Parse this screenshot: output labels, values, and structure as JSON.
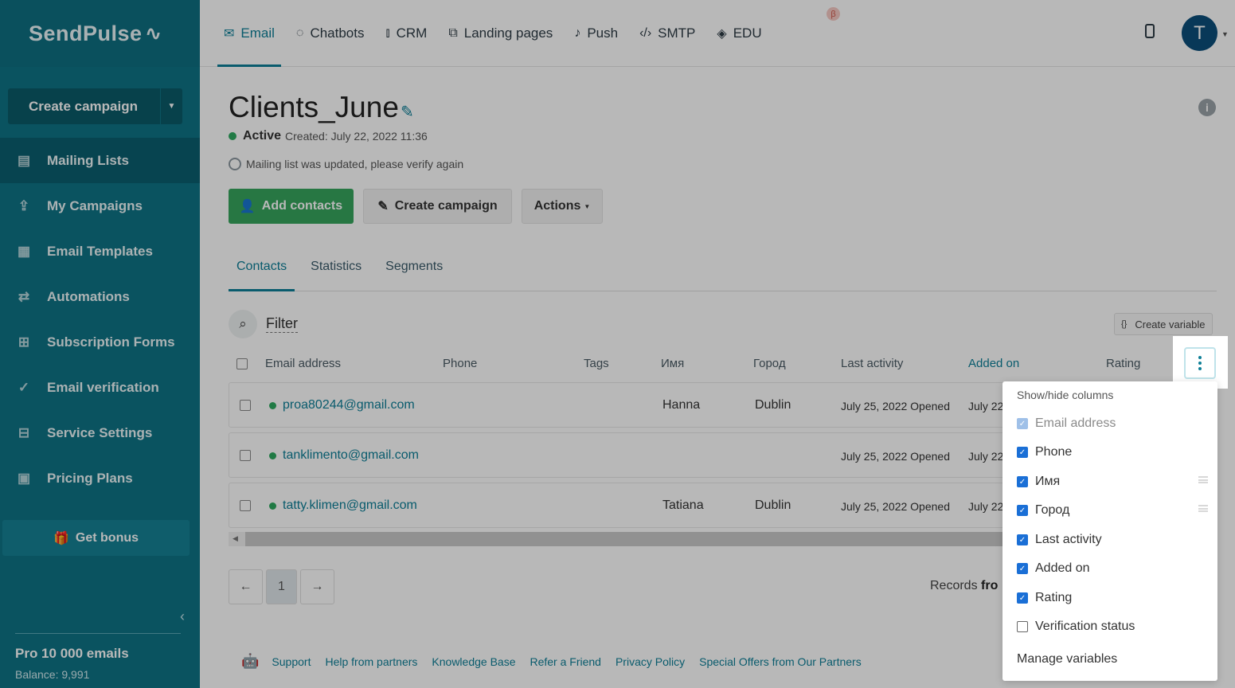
{
  "sidebar": {
    "logo": "SendPulse",
    "create_campaign": "Create campaign",
    "items": [
      {
        "label": "Mailing Lists",
        "icon": "address-book-icon"
      },
      {
        "label": "My Campaigns",
        "icon": "campaigns-icon"
      },
      {
        "label": "Email Templates",
        "icon": "templates-icon"
      },
      {
        "label": "Automations",
        "icon": "automations-icon"
      },
      {
        "label": "Subscription Forms",
        "icon": "forms-icon"
      },
      {
        "label": "Email verification",
        "icon": "verify-icon"
      },
      {
        "label": "Service Settings",
        "icon": "settings-icon"
      },
      {
        "label": "Pricing Plans",
        "icon": "wallet-icon"
      }
    ],
    "bonus": "Get bonus",
    "plan": "Pro 10 000 emails",
    "balance": "Balance: 9,991"
  },
  "topnav": {
    "items": [
      "Email",
      "Chatbots",
      "CRM",
      "Landing pages",
      "Push",
      "SMTP",
      "EDU"
    ],
    "beta_badge": "β",
    "avatar_letter": "T"
  },
  "page": {
    "title": "Clients_June",
    "status": "Active",
    "created": "Created: July 22, 2022 11:36",
    "update_notice": "Mailing list was updated, please verify again",
    "add_contacts": "Add contacts",
    "create_campaign": "Create campaign",
    "actions": "Actions"
  },
  "tabs": [
    "Contacts",
    "Statistics",
    "Segments"
  ],
  "filter": "Filter",
  "create_variable": "Create variable",
  "table": {
    "headers": {
      "email": "Email address",
      "phone": "Phone",
      "tags": "Tags",
      "name": "Имя",
      "city": "Город",
      "last_activity": "Last activity",
      "added_on": "Added on",
      "rating": "Rating"
    },
    "rows": [
      {
        "email": "proa80244@gmail.com",
        "name": "Hanna",
        "city": "Dublin",
        "activity": "July 25, 2022 Opened",
        "added": "July 22"
      },
      {
        "email": "tanklimento@gmail.com",
        "name": "",
        "city": "",
        "activity": "July 25, 2022 Opened",
        "added": "July 22"
      },
      {
        "email": "tatty.klimen@gmail.com",
        "name": "Tatiana",
        "city": "Dublin",
        "activity": "July 25, 2022 Opened",
        "added": "July 22"
      }
    ]
  },
  "pagination": {
    "prev": "←",
    "page": "1",
    "next": "→",
    "records_prefix": "Records",
    "records_bold": "fro"
  },
  "footer": [
    "Support",
    "Help from partners",
    "Knowledge Base",
    "Refer a Friend",
    "Privacy Policy",
    "Special Offers from Our Partners"
  ],
  "dropdown": {
    "title": "Show/hide columns",
    "options": [
      {
        "label": "Email address",
        "checked": true,
        "disabled": true
      },
      {
        "label": "Phone",
        "checked": true
      },
      {
        "label": "Имя",
        "checked": true
      },
      {
        "label": "Город",
        "checked": true
      },
      {
        "label": "Last activity",
        "checked": true
      },
      {
        "label": "Added on",
        "checked": true
      },
      {
        "label": "Rating",
        "checked": true
      },
      {
        "label": "Verification status",
        "checked": false
      }
    ],
    "manage": "Manage variables"
  },
  "colors": {
    "accent": "#0d7f97",
    "sidebar": "#0e7386",
    "green": "#36a65d",
    "checkbox": "#1a6fd6"
  }
}
